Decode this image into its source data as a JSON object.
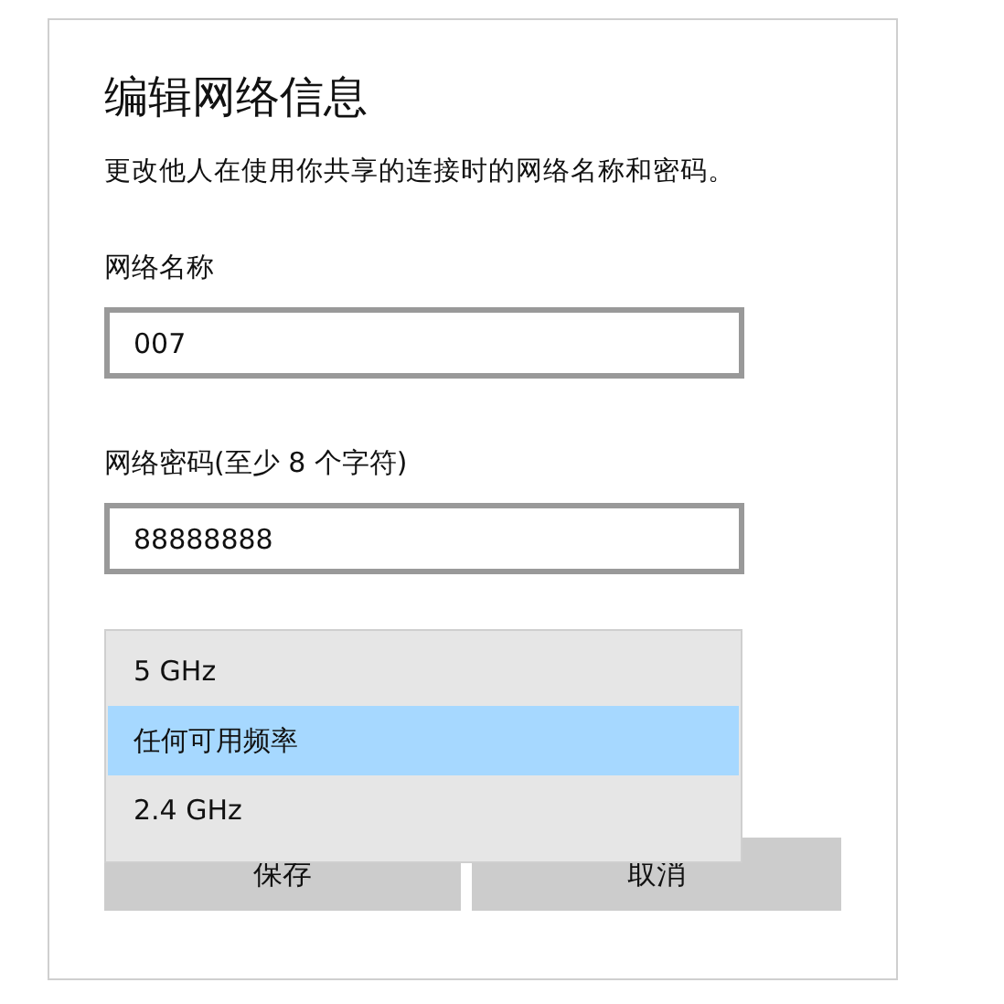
{
  "dialog": {
    "title": "编辑网络信息",
    "description": "更改他人在使用你共享的连接时的网络名称和密码。",
    "network_name": {
      "label": "网络名称",
      "value": "007"
    },
    "network_password": {
      "label": "网络密码(至少 8 个字符)",
      "value": "88888888"
    },
    "band_dropdown": {
      "options": [
        {
          "label": "5 GHz",
          "selected": false
        },
        {
          "label": "任何可用频率",
          "selected": true
        },
        {
          "label": "2.4 GHz",
          "selected": false
        }
      ]
    },
    "buttons": [
      "保存",
      "取消"
    ]
  }
}
